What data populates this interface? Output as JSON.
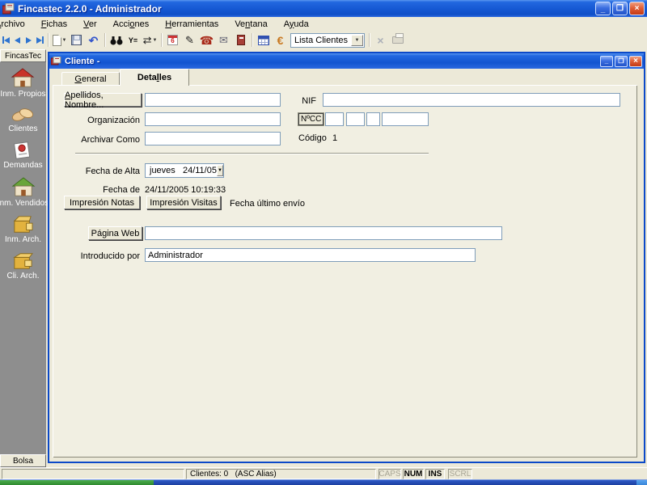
{
  "window": {
    "title": "Fincastec 2.2.0 - Administrador",
    "controls": {
      "minimize": "_",
      "restore": "❐",
      "close": "×"
    }
  },
  "menu": {
    "items": [
      {
        "pre": "",
        "key": "A",
        "post": "rchivo"
      },
      {
        "pre": "",
        "key": "F",
        "post": "ichas"
      },
      {
        "pre": "",
        "key": "V",
        "post": "er"
      },
      {
        "pre": "Acci",
        "key": "o",
        "post": "nes"
      },
      {
        "pre": "",
        "key": "H",
        "post": "erramientas"
      },
      {
        "pre": "Ve",
        "key": "n",
        "post": "tana"
      },
      {
        "pre": "A",
        "key": "y",
        "post": "uda"
      }
    ]
  },
  "toolbar": {
    "list_combo_value": "Lista Clientes",
    "glyphs": {
      "undo": "↶",
      "refresh": "⇄",
      "filter": "Y=",
      "edit": "✎",
      "phone": "☎",
      "mail": "✉",
      "euro": "€",
      "delete": "×",
      "calendar_day": "6",
      "dropdown": "▼"
    }
  },
  "sidebar": {
    "header": "FincasTec",
    "items": [
      {
        "label": "Inm. Propios",
        "icon": "red-house-icon"
      },
      {
        "label": "Clientes",
        "icon": "handshake-icon"
      },
      {
        "label": "Demandas",
        "icon": "demand-document-icon"
      },
      {
        "label": "Inm. Vendidos",
        "icon": "green-house-icon"
      },
      {
        "label": "Inm. Arch.",
        "icon": "archive-box-icon"
      },
      {
        "label": "Cli. Arch.",
        "icon": "archive-box-icon"
      }
    ],
    "footer": "Bolsa"
  },
  "client_window": {
    "title": "Cliente -",
    "controls": {
      "minimize": "_",
      "maximize": "❐",
      "close": "×"
    },
    "tabs": {
      "general": {
        "pre": "",
        "key": "G",
        "post": "eneral"
      },
      "detalles": {
        "pre": "Deta",
        "key": "l",
        "post": "les"
      }
    },
    "form": {
      "apellidos_button": {
        "pre": "",
        "key": "A",
        "post": "pellidos, Nombre..."
      },
      "organizacion_label": "Organización",
      "archivar_label": "Archivar Como",
      "nif_label": "NIF",
      "ncc_label": "NºCC",
      "codigo_label": "Código",
      "codigo_value": "1",
      "fecha_alta_label": "Fecha de Alta",
      "fecha_alta_value": "jueves   24/11/05",
      "fecha_actualizacion_label": "Fecha de Actualización",
      "fecha_actualizacion_value": "24/11/2005 10:19:33",
      "impresion_notas_button": "Impresión Notas",
      "impresion_visitas_button": "Impresión Visitas",
      "fecha_ultimo_envio_label": "Fecha último envío",
      "pagina_web_button": "Página Web",
      "introducido_label": "Introducido por",
      "introducido_value": "Administrador"
    }
  },
  "statusbar": {
    "clientes_text": "Clientes: 0   (ASC Alias)",
    "indicators": [
      {
        "label": "CAPS",
        "active": false
      },
      {
        "label": "NUM",
        "active": true
      },
      {
        "label": "INS",
        "active": true
      },
      {
        "label": "SCRL",
        "active": false
      }
    ]
  },
  "colors": {
    "titlebar_blue": "#1557d2",
    "window_face": "#ECE9D8",
    "sidebar_gray": "#8e8e8e",
    "child_border_blue": "#0b49c8",
    "field_border": "#7F9DB9",
    "taskbar_green": "#37993a",
    "taskbar_blue": "#2148b1",
    "taskbar_light_blue": "#459ee8"
  }
}
